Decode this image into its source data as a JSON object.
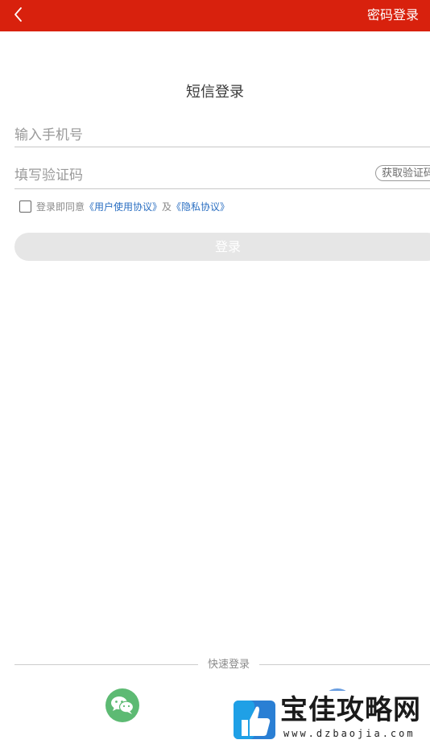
{
  "header": {
    "back_icon": "chevron-left-icon",
    "password_login_label": "密码登录",
    "bg_color": "#d8210d"
  },
  "main": {
    "title": "短信登录",
    "phone_placeholder": "输入手机号",
    "code_placeholder": "填写验证码",
    "get_code_label": "获取验证码",
    "agree_prefix": "登录即同意",
    "user_agreement_link": "《用户使用协议》",
    "agree_conjunction": "及",
    "privacy_link": "《隐私协议》",
    "login_button_label": "登录",
    "link_color": "#2b6fc2"
  },
  "quick_login": {
    "label": "快速登录",
    "wechat_icon": "wechat-icon",
    "wechat_color": "#5dba73"
  },
  "watermark": {
    "title": "宝佳攻略网",
    "url": "www.dzbaojia.com"
  }
}
